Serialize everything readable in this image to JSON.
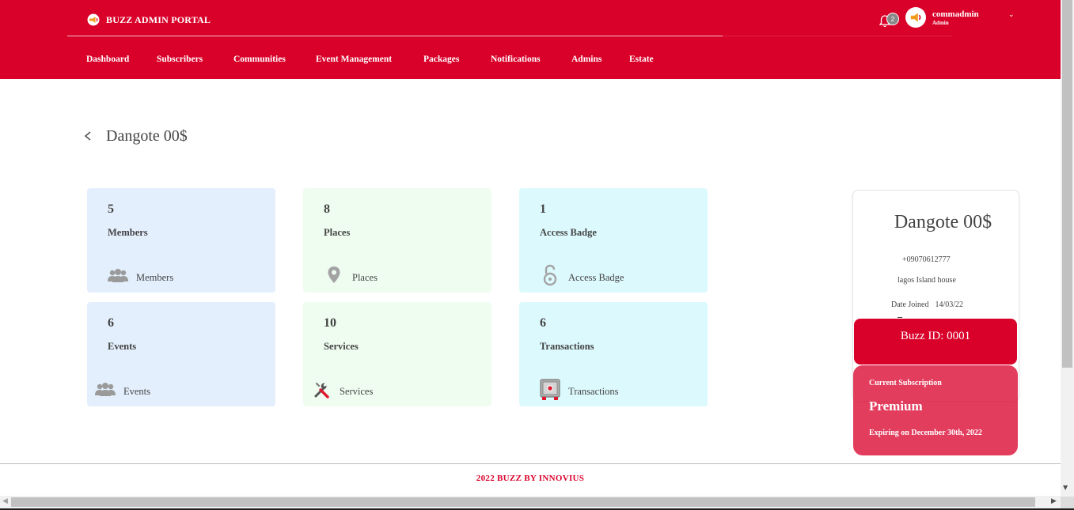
{
  "colors": {
    "brand": "#d9002a",
    "card_blue": "#e3effd",
    "card_green": "#effdf0",
    "card_cyan": "#dcf9fd"
  },
  "header": {
    "brand_title": "BUZZ ADMIN PORTAL",
    "logo_icon": "megaphone-icon",
    "notifications_count": "2",
    "user_name": "commadmin",
    "user_role": "Admin",
    "caret": "⌄"
  },
  "nav": [
    "Dashboard",
    "Subscribers",
    "Communities",
    "Event Management",
    "Packages",
    "Notifications",
    "Admins",
    "Estate"
  ],
  "page": {
    "title": "Dangote 00$",
    "back_icon": "chevron-left-icon"
  },
  "stats": [
    {
      "value": "5",
      "label": "Members",
      "footer": "Members",
      "icon": "users-icon"
    },
    {
      "value": "8",
      "label": "Places",
      "footer": "Places",
      "icon": "map-pin-icon"
    },
    {
      "value": "1",
      "label": "Access Badge",
      "footer": "Access Badge",
      "icon": "lock-icon"
    },
    {
      "value": "6",
      "label": "Events",
      "footer": "Events",
      "icon": "users-icon"
    },
    {
      "value": "10",
      "label": "Services",
      "footer": "Services",
      "icon": "tools-icon"
    },
    {
      "value": "6",
      "label": "Transactions",
      "footer": "Transactions",
      "icon": "safe-icon"
    }
  ],
  "profile": {
    "name": "Dangote 00$",
    "phone": "+09070612777",
    "address": "lagos Island house",
    "date_joined_label": "Date Joined",
    "date_joined": "14/03/22",
    "buzz_id": "Buzz ID: 0001"
  },
  "subscription": {
    "title": "Current Subscription",
    "plan": "Premium",
    "expiry": "Expiring on December 30th, 2022"
  },
  "footer": {
    "text": "2022 BUZZ BY INNOVIUS"
  }
}
